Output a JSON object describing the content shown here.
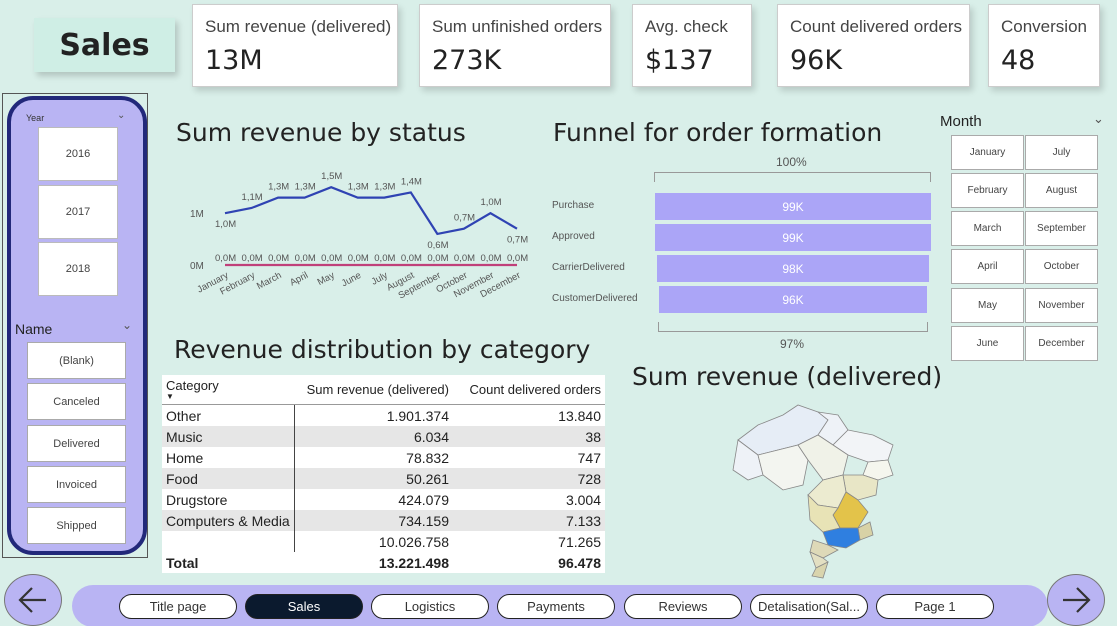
{
  "page_title": "Sales",
  "kpis": [
    {
      "label": "Sum revenue (delivered)",
      "value": "13M"
    },
    {
      "label": "Sum unfinished orders",
      "value": "273K"
    },
    {
      "label": "Avg. check",
      "value": "$137"
    },
    {
      "label": "Count delivered orders",
      "value": "96K"
    },
    {
      "label": "Conversion",
      "value": "48"
    }
  ],
  "year_slicer": {
    "title": "Year",
    "options": [
      "2016",
      "2017",
      "2018"
    ]
  },
  "name_slicer": {
    "title": "Name",
    "options": [
      "(Blank)",
      "Canceled",
      "Delivered",
      "Invoiced",
      "Shipped"
    ]
  },
  "line_chart": {
    "title": "Sum revenue by status",
    "y_tick_top": "1M",
    "y_tick_bottom": "0M"
  },
  "chart_data": [
    {
      "type": "line",
      "title": "Sum revenue by status",
      "categories": [
        "January",
        "February",
        "March",
        "April",
        "May",
        "June",
        "July",
        "August",
        "September",
        "October",
        "November",
        "December"
      ],
      "series": [
        {
          "values": [
            1.0,
            1.1,
            1.3,
            1.3,
            1.5,
            1.3,
            1.3,
            1.4,
            0.6,
            0.7,
            1.0,
            0.7
          ],
          "labels": [
            "1,0M",
            "1,1M",
            "1,3M",
            "1,3M",
            "1,5M",
            "1,3M",
            "1,3M",
            "1,4M",
            "0,6M",
            "0,7M",
            "1,0M",
            "0,7M"
          ],
          "color": "#2f43b3"
        },
        {
          "values": [
            0,
            0,
            0,
            0,
            0,
            0,
            0,
            0,
            0,
            0,
            0,
            0
          ],
          "labels": [
            "0,0M",
            "0,0M",
            "0,0M",
            "0,0M",
            "0,0M",
            "0,0M",
            "0,0M",
            "0,0M",
            "0,0M",
            "0,0M",
            "0,0M",
            "0,0M"
          ],
          "color": "#c0407a"
        }
      ]
    },
    {
      "type": "bar",
      "title": "Funnel for order formation",
      "categories": [
        "Purchase",
        "Approved",
        "CarrierDelivered",
        "CustomerDelivered"
      ],
      "values": [
        99,
        99,
        98,
        96
      ],
      "labels": [
        "99K",
        "99K",
        "98K",
        "96K"
      ],
      "top_percent": "100%",
      "bottom_percent": "97%"
    }
  ],
  "funnel": {
    "title": "Funnel for order formation",
    "top_percent": "100%",
    "bottom_percent": "97%",
    "stages": [
      {
        "label": "Purchase",
        "value": "99K"
      },
      {
        "label": "Approved",
        "value": "99K"
      },
      {
        "label": "CarrierDelivered",
        "value": "98K"
      },
      {
        "label": "CustomerDelivered",
        "value": "96K"
      }
    ]
  },
  "month_slicer": {
    "title": "Month",
    "col1": [
      "January",
      "February",
      "March",
      "April",
      "May",
      "June"
    ],
    "col2": [
      "July",
      "August",
      "September",
      "October",
      "November",
      "December"
    ]
  },
  "table": {
    "title": "Revenue distribution by category",
    "headers": [
      "Category",
      "Sum revenue (delivered)",
      "Count delivered orders"
    ],
    "rows": [
      [
        "Other",
        "1.901.374",
        "13.840"
      ],
      [
        "Music",
        "6.034",
        "38"
      ],
      [
        "Home",
        "78.832",
        "747"
      ],
      [
        "Food",
        "50.261",
        "728"
      ],
      [
        "Drugstore",
        "424.079",
        "3.004"
      ],
      [
        "Computers & Media",
        "734.159",
        "7.133"
      ],
      [
        "",
        "10.026.758",
        "71.265"
      ]
    ],
    "total": [
      "Total",
      "13.221.498",
      "96.478"
    ]
  },
  "map": {
    "title": "Sum revenue (delivered)"
  },
  "nav": {
    "tabs": [
      "Title page",
      "Sales",
      "Logistics",
      "Payments",
      "Reviews",
      "Detalisation(Sal...",
      "Page 1"
    ],
    "active": "Sales"
  },
  "colors": {
    "background": "#d9efe9",
    "accent": "#b9b4f3",
    "panel_border": "#22287a",
    "line": "#2f43b3",
    "zero_line": "#c0407a",
    "funnel": "#aba5f7"
  }
}
